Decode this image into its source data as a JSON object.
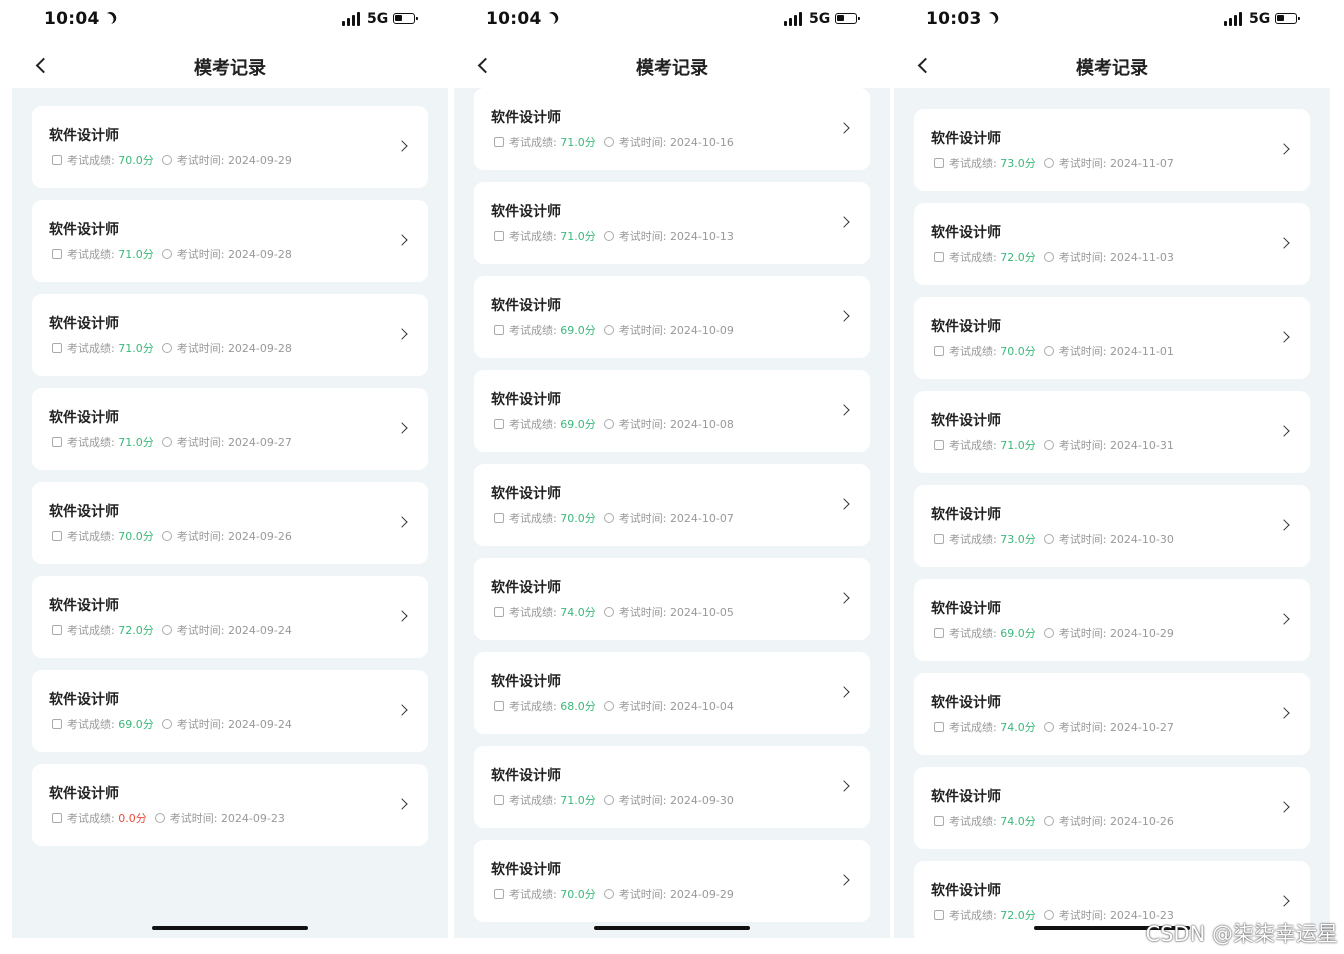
{
  "screens": [
    {
      "time": "10:04",
      "network": "5G",
      "title": "模考记录",
      "records": [
        {
          "name": "软件设计师",
          "score_label": "考试成绩:",
          "score": "70.0分",
          "time_label": "考试时间:",
          "date": "2024-09-29"
        },
        {
          "name": "软件设计师",
          "score_label": "考试成绩:",
          "score": "71.0分",
          "time_label": "考试时间:",
          "date": "2024-09-28"
        },
        {
          "name": "软件设计师",
          "score_label": "考试成绩:",
          "score": "71.0分",
          "time_label": "考试时间:",
          "date": "2024-09-28"
        },
        {
          "name": "软件设计师",
          "score_label": "考试成绩:",
          "score": "71.0分",
          "time_label": "考试时间:",
          "date": "2024-09-27"
        },
        {
          "name": "软件设计师",
          "score_label": "考试成绩:",
          "score": "70.0分",
          "time_label": "考试时间:",
          "date": "2024-09-26"
        },
        {
          "name": "软件设计师",
          "score_label": "考试成绩:",
          "score": "72.0分",
          "time_label": "考试时间:",
          "date": "2024-09-24"
        },
        {
          "name": "软件设计师",
          "score_label": "考试成绩:",
          "score": "69.0分",
          "time_label": "考试时间:",
          "date": "2024-09-24"
        },
        {
          "name": "软件设计师",
          "score_label": "考试成绩:",
          "score": "0.0分",
          "time_label": "考试时间:",
          "date": "2024-09-23"
        }
      ]
    },
    {
      "time": "10:04",
      "network": "5G",
      "title": "模考记录",
      "records": [
        {
          "name": "软件设计师",
          "score_label": "考试成绩:",
          "score": "71.0分",
          "time_label": "考试时间:",
          "date": "2024-10-16"
        },
        {
          "name": "软件设计师",
          "score_label": "考试成绩:",
          "score": "71.0分",
          "time_label": "考试时间:",
          "date": "2024-10-13"
        },
        {
          "name": "软件设计师",
          "score_label": "考试成绩:",
          "score": "69.0分",
          "time_label": "考试时间:",
          "date": "2024-10-09"
        },
        {
          "name": "软件设计师",
          "score_label": "考试成绩:",
          "score": "69.0分",
          "time_label": "考试时间:",
          "date": "2024-10-08"
        },
        {
          "name": "软件设计师",
          "score_label": "考试成绩:",
          "score": "70.0分",
          "time_label": "考试时间:",
          "date": "2024-10-07"
        },
        {
          "name": "软件设计师",
          "score_label": "考试成绩:",
          "score": "74.0分",
          "time_label": "考试时间:",
          "date": "2024-10-05"
        },
        {
          "name": "软件设计师",
          "score_label": "考试成绩:",
          "score": "68.0分",
          "time_label": "考试时间:",
          "date": "2024-10-04"
        },
        {
          "name": "软件设计师",
          "score_label": "考试成绩:",
          "score": "71.0分",
          "time_label": "考试时间:",
          "date": "2024-09-30"
        },
        {
          "name": "软件设计师",
          "score_label": "考试成绩:",
          "score": "70.0分",
          "time_label": "考试时间:",
          "date": "2024-09-29"
        }
      ]
    },
    {
      "time": "10:03",
      "network": "5G",
      "title": "模考记录",
      "records": [
        {
          "name": "软件设计师",
          "score_label": "考试成绩:",
          "score": "73.0分",
          "time_label": "考试时间:",
          "date": "2024-11-07"
        },
        {
          "name": "软件设计师",
          "score_label": "考试成绩:",
          "score": "72.0分",
          "time_label": "考试时间:",
          "date": "2024-11-03"
        },
        {
          "name": "软件设计师",
          "score_label": "考试成绩:",
          "score": "70.0分",
          "time_label": "考试时间:",
          "date": "2024-11-01"
        },
        {
          "name": "软件设计师",
          "score_label": "考试成绩:",
          "score": "71.0分",
          "time_label": "考试时间:",
          "date": "2024-10-31"
        },
        {
          "name": "软件设计师",
          "score_label": "考试成绩:",
          "score": "73.0分",
          "time_label": "考试时间:",
          "date": "2024-10-30"
        },
        {
          "name": "软件设计师",
          "score_label": "考试成绩:",
          "score": "69.0分",
          "time_label": "考试时间:",
          "date": "2024-10-29"
        },
        {
          "name": "软件设计师",
          "score_label": "考试成绩:",
          "score": "74.0分",
          "time_label": "考试时间:",
          "date": "2024-10-27"
        },
        {
          "name": "软件设计师",
          "score_label": "考试成绩:",
          "score": "74.0分",
          "time_label": "考试时间:",
          "date": "2024-10-26"
        },
        {
          "name": "软件设计师",
          "score_label": "考试成绩:",
          "score": "72.0分",
          "time_label": "考试时间:",
          "date": "2024-10-23"
        }
      ]
    }
  ],
  "watermark": "CSDN @柒柒幸运星",
  "colors": {
    "score_green": "#3bb87a",
    "score_red": "#e84c3d",
    "background": "#eff5f7"
  }
}
